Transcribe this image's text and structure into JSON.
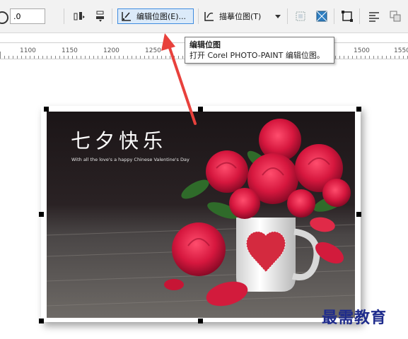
{
  "toolbar": {
    "angle_value": ".0",
    "edit_bitmap_label": "编辑位图(E)...",
    "trace_bitmap_label": "描摹位图(T)"
  },
  "ruler": {
    "labels": [
      "1100",
      "1150",
      "1200",
      "1250",
      "1500",
      "1550"
    ]
  },
  "tooltip": {
    "title": "编辑位图",
    "description": "打开 Corel PHOTO-PAINT 编辑位图。"
  },
  "image": {
    "title": "七夕快乐",
    "subtitle": "With all the love's a happy Chinese Valentine's Day"
  },
  "watermark": "最需教育",
  "colors": {
    "accent": "#3f8ce0",
    "button_bg": "#dbeaf9",
    "arrow": "#e8413c",
    "watermark": "#1e2b8c"
  }
}
